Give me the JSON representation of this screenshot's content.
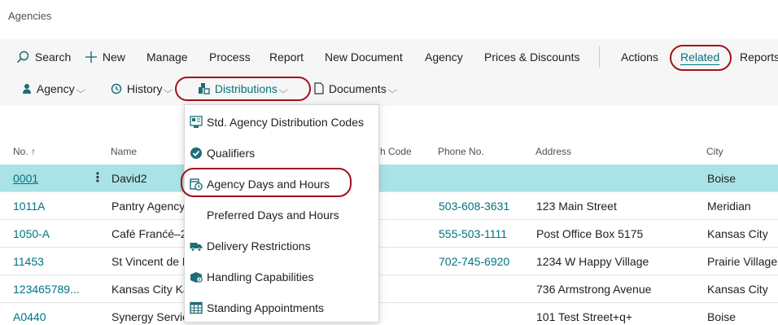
{
  "page": {
    "title": "Agencies"
  },
  "action_bar": {
    "search": "Search",
    "new": "New",
    "manage": "Manage",
    "process": "Process",
    "report": "Report",
    "new_document": "New Document",
    "agency": "Agency",
    "prices_discounts": "Prices & Discounts",
    "actions": "Actions",
    "related": "Related",
    "reports": "Reports"
  },
  "sub_bar": {
    "agency": "Agency",
    "history": "History",
    "distributions": "Distributions",
    "documents": "Documents"
  },
  "dropdown": {
    "items": [
      {
        "label": "Std. Agency Distribution Codes",
        "icon": "distribution-codes-icon"
      },
      {
        "label": "Qualifiers",
        "icon": "check-circle-icon"
      },
      {
        "label": "Agency Days and Hours",
        "icon": "calendar-clock-icon"
      },
      {
        "label": "Preferred Days and Hours",
        "icon": ""
      },
      {
        "label": "Delivery Restrictions",
        "icon": "truck-icon"
      },
      {
        "label": "Handling Capabilities",
        "icon": "box-icon"
      },
      {
        "label": "Standing Appointments",
        "icon": "grid-calendar-icon"
      }
    ]
  },
  "table": {
    "columns": {
      "no": "No. ↑",
      "name": "Name",
      "branch_code": "h Code",
      "phone": "Phone No.",
      "address": "Address",
      "city": "City"
    },
    "rows": [
      {
        "no": "0001",
        "name": "David2",
        "phone": "",
        "address": "",
        "city": "Boise"
      },
      {
        "no": "1011A",
        "name": "Pantry Agency",
        "phone": "503-608-3631",
        "address": "123 Main Street",
        "city": "Meridian"
      },
      {
        "no": "1050-A",
        "name": "Café Franćé–2",
        "phone": "555-503-1111",
        "address": "Post Office Box 5175",
        "city": "Kansas City"
      },
      {
        "no": "11453",
        "name": "St Vincent de P",
        "phone": "702-745-6920",
        "address": "1234 W Happy Village",
        "city": "Prairie Village"
      },
      {
        "no": "123465789...",
        "name": "Kansas City Kar",
        "phone": "",
        "address": "736 Armstrong Avenue",
        "city": "Kansas City"
      },
      {
        "no": "A0440",
        "name": "Synergy Servic",
        "phone": "",
        "address": "101 Test Street+q+",
        "city": "Boise"
      }
    ]
  },
  "colors": {
    "accent": "#00737e",
    "highlight_ring": "#a3101c",
    "selected_row": "#a9e3e7"
  }
}
